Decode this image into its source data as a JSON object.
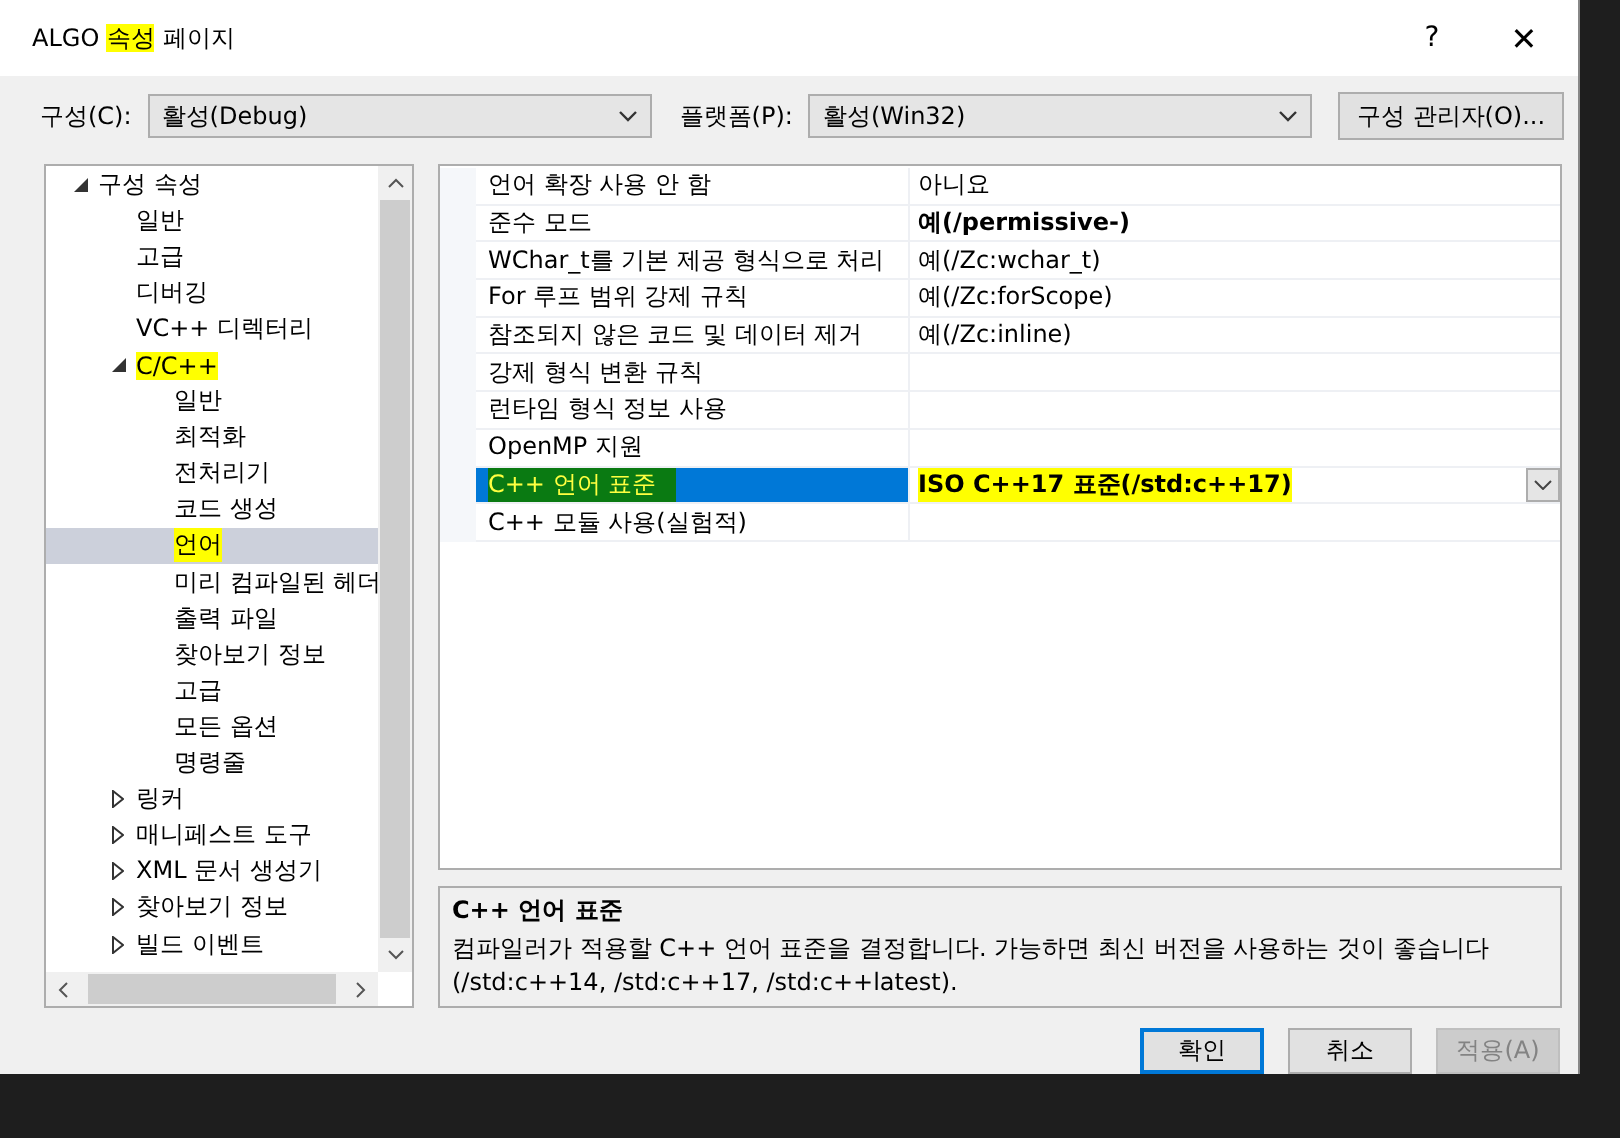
{
  "window": {
    "title_parts": [
      {
        "text": "ALGO ",
        "highlighted": false
      },
      {
        "text": "속성",
        "highlighted": true
      },
      {
        "text": " 페이지",
        "highlighted": false
      }
    ],
    "help": "?",
    "close": "✕"
  },
  "toolbar": {
    "configuration": {
      "label": "구성(C):",
      "value": "활성(Debug)"
    },
    "platform": {
      "label": "플랫폼(P):",
      "value": "활성(Win32)"
    },
    "manager_button": "구성 관리자(O)..."
  },
  "tree": [
    {
      "label": "구성 속성",
      "expanded": true,
      "selected": false,
      "highlighted": false,
      "children": [
        {
          "label": "일반",
          "selected": false,
          "highlighted": false
        },
        {
          "label": "고급",
          "selected": false,
          "highlighted": false
        },
        {
          "label": "디버깅",
          "selected": false,
          "highlighted": false
        },
        {
          "label": "VC++ 디렉터리",
          "selected": false,
          "highlighted": false
        },
        {
          "label": "C/C++",
          "expanded": true,
          "selected": false,
          "highlighted": true,
          "children": [
            {
              "label": "일반",
              "selected": false,
              "highlighted": false
            },
            {
              "label": "최적화",
              "selected": false,
              "highlighted": false
            },
            {
              "label": "전처리기",
              "selected": false,
              "highlighted": false
            },
            {
              "label": "코드 생성",
              "selected": false,
              "highlighted": false
            },
            {
              "label": "언어",
              "selected": true,
              "highlighted": true
            },
            {
              "label": "미리 컴파일된 헤더",
              "selected": false,
              "highlighted": false
            },
            {
              "label": "출력 파일",
              "selected": false,
              "highlighted": false
            },
            {
              "label": "찾아보기 정보",
              "selected": false,
              "highlighted": false
            },
            {
              "label": "고급",
              "selected": false,
              "highlighted": false
            },
            {
              "label": "모든 옵션",
              "selected": false,
              "highlighted": false
            },
            {
              "label": "명령줄",
              "selected": false,
              "highlighted": false
            }
          ]
        },
        {
          "label": "링커",
          "expanded": false,
          "selected": false,
          "highlighted": false
        },
        {
          "label": "매니페스트 도구",
          "expanded": false,
          "selected": false,
          "highlighted": false
        },
        {
          "label": "XML 문서 생성기",
          "expanded": false,
          "selected": false,
          "highlighted": false
        },
        {
          "label": "찾아보기 정보",
          "expanded": false,
          "selected": false,
          "highlighted": false
        },
        {
          "label": "빌드 이벤트",
          "expanded": false,
          "selected": false,
          "highlighted": false
        }
      ]
    }
  ],
  "properties": [
    {
      "name": "언어 확장 사용 안 함",
      "value": "아니요",
      "bold": false,
      "selected": false,
      "highlighted": false
    },
    {
      "name": "준수 모드",
      "value": "예(/permissive-)",
      "bold": true,
      "selected": false,
      "highlighted": false
    },
    {
      "name": "WChar_t를 기본 제공 형식으로 처리",
      "value": "예(/Zc:wchar_t)",
      "bold": false,
      "selected": false,
      "highlighted": false
    },
    {
      "name": "For 루프 범위 강제 규칙",
      "value": "예(/Zc:forScope)",
      "bold": false,
      "selected": false,
      "highlighted": false
    },
    {
      "name": "참조되지 않은 코드 및 데이터 제거",
      "value": "예(/Zc:inline)",
      "bold": false,
      "selected": false,
      "highlighted": false
    },
    {
      "name": "강제 형식 변환 규칙",
      "selected": false,
      "highlighted": false
    },
    {
      "name": "런타임 형식 정보 사용",
      "selected": false,
      "highlighted": false
    },
    {
      "name": "OpenMP 지원",
      "selected": false,
      "highlighted": false
    },
    {
      "name": "C++ 언어 표준",
      "value": "ISO C++17 표준(/std:c++17)",
      "bold": true,
      "selected": true,
      "highlighted": true
    },
    {
      "name": "C++ 모듈 사용(실험적)",
      "selected": false,
      "highlighted": false
    }
  ],
  "description": {
    "title": "C++ 언어 표준",
    "text": "컴파일러가 적용할 C++ 언어 표준을 결정합니다. 가능하면 최신 버전을 사용하는 것이 좋습니다 (/std:c++14, /std:c++17, /std:c++latest)."
  },
  "buttons": [
    {
      "label": "확인",
      "kind": "default",
      "disabled": false
    },
    {
      "label": "취소",
      "kind": "normal",
      "disabled": false
    },
    {
      "label": "적용(A)",
      "kind": "normal",
      "disabled": true
    }
  ]
}
